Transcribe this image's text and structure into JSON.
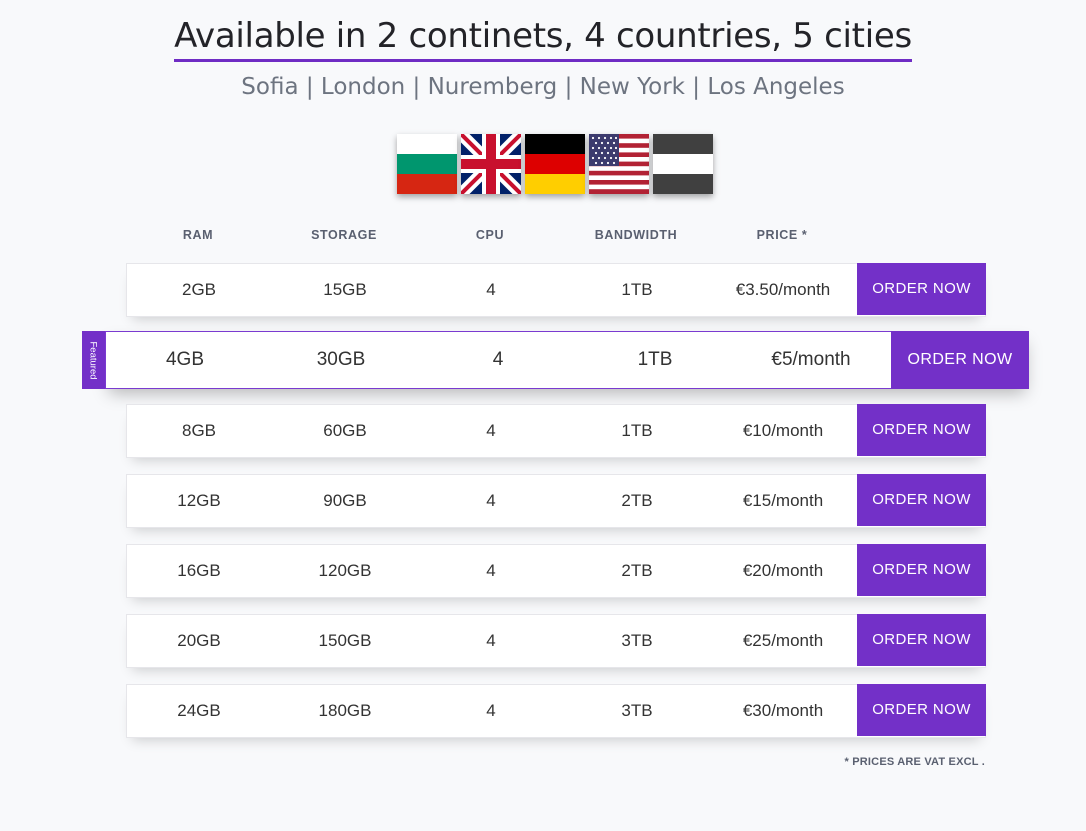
{
  "headline": "Available in 2 continets, 4 countries, 5 cities",
  "cities": "Sofia | London | Nuremberg | New York | Los Angeles",
  "flags": [
    {
      "country": "Bulgaria",
      "icon": "bulgaria-flag-icon"
    },
    {
      "country": "United Kingdom",
      "icon": "uk-flag-icon"
    },
    {
      "country": "Germany",
      "icon": "germany-flag-icon"
    },
    {
      "country": "United States",
      "icon": "usa-flag-icon"
    },
    {
      "country": "Los Angeles",
      "icon": "la-flag-icon"
    }
  ],
  "columns": {
    "ram": "RAM",
    "storage": "STORAGE",
    "cpu": "CPU",
    "bandwidth": "BANDWIDTH",
    "price": "PRICE *"
  },
  "featured_label": "Featured",
  "plans": [
    {
      "ram": "2GB",
      "storage": "15GB",
      "cpu": "4",
      "bandwidth": "1TB",
      "price": "€3.50/month",
      "order_label": "ORDER NOW"
    },
    {
      "ram": "4GB",
      "storage": "30GB",
      "cpu": "4",
      "bandwidth": "1TB",
      "price": "€5/month",
      "order_label": "ORDER NOW"
    },
    {
      "ram": "8GB",
      "storage": "60GB",
      "cpu": "4",
      "bandwidth": "1TB",
      "price": "€10/month",
      "order_label": "ORDER NOW"
    },
    {
      "ram": "12GB",
      "storage": "90GB",
      "cpu": "4",
      "bandwidth": "2TB",
      "price": "€15/month",
      "order_label": "ORDER NOW"
    },
    {
      "ram": "16GB",
      "storage": "120GB",
      "cpu": "4",
      "bandwidth": "2TB",
      "price": "€20/month",
      "order_label": "ORDER NOW"
    },
    {
      "ram": "20GB",
      "storage": "150GB",
      "cpu": "4",
      "bandwidth": "3TB",
      "price": "€25/month",
      "order_label": "ORDER NOW"
    },
    {
      "ram": "24GB",
      "storage": "180GB",
      "cpu": "4",
      "bandwidth": "3TB",
      "price": "€30/month",
      "order_label": "ORDER NOW"
    }
  ],
  "vat_note": "* PRICES ARE VAT EXCL .",
  "colors": {
    "accent": "#7330c8",
    "background": "#f8f9fb",
    "headline": "#232328",
    "cities": "#6d7480"
  }
}
